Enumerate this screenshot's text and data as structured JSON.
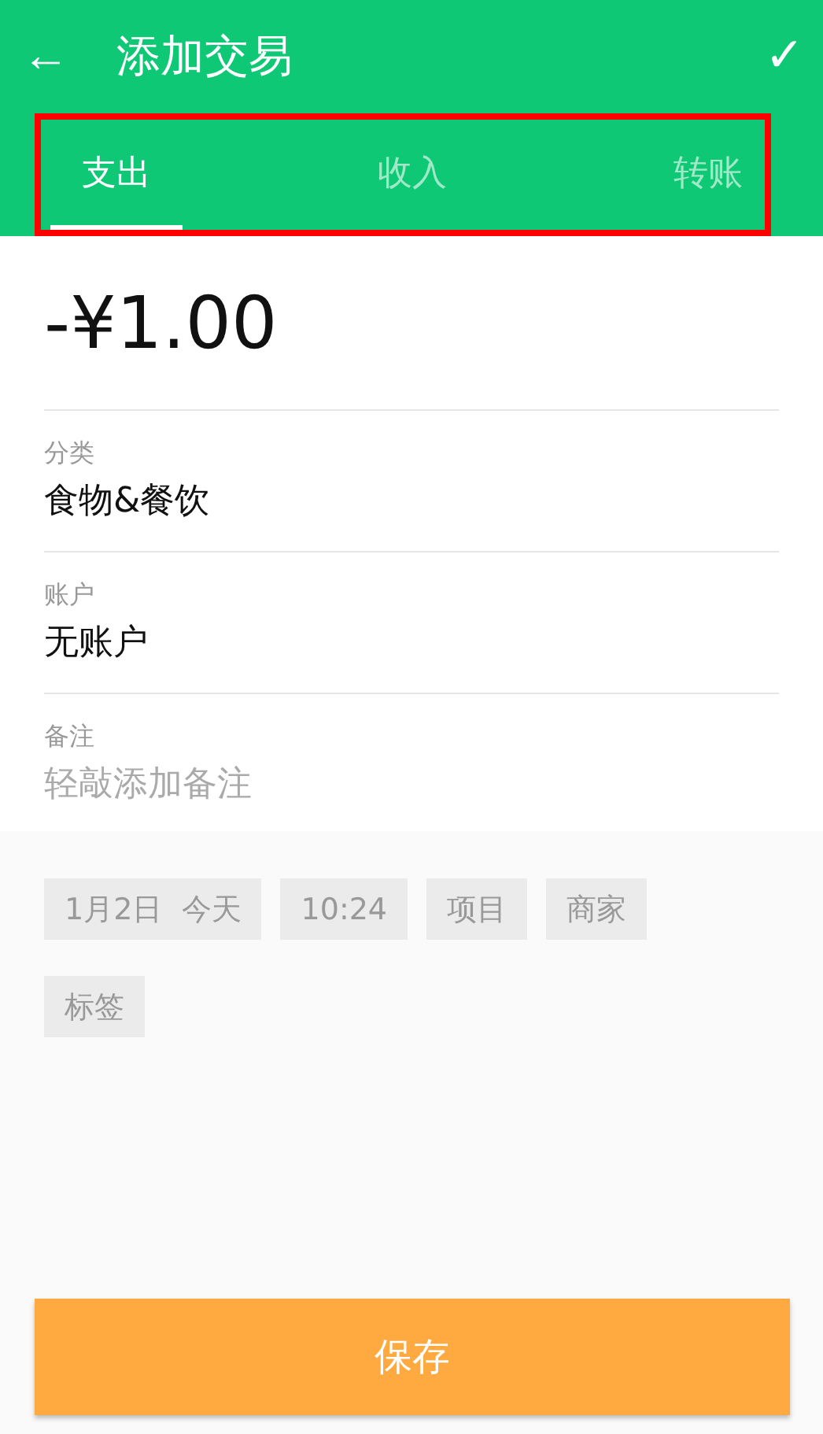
{
  "toolbar": {
    "back": "←",
    "title": "添加交易",
    "confirm": "✓"
  },
  "tabs": [
    {
      "label": "支出",
      "selected": true
    },
    {
      "label": "收入",
      "selected": false
    },
    {
      "label": "转账",
      "selected": false
    }
  ],
  "tabs_highlighted": true,
  "amount": "-¥1.00",
  "fields": [
    {
      "label": "分类",
      "value": "食物&餐饮"
    },
    {
      "label": "账户",
      "value": "无账户"
    },
    {
      "label": "备注",
      "placeholder": "轻敲添加备注"
    }
  ],
  "chips": [
    "1月2日  今天",
    "10:24",
    "项目",
    "商家",
    "标签"
  ],
  "save_button": "保存"
}
